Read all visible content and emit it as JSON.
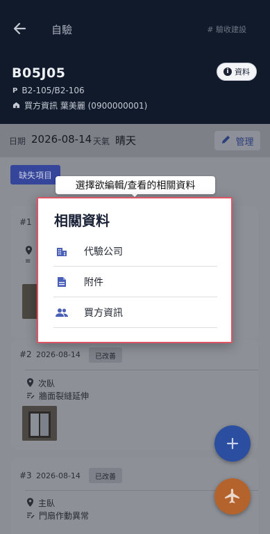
{
  "header": {
    "title": "自驗",
    "hashtag": "# 驗收建設",
    "code": "B05J05",
    "info_label": "資料",
    "unit_prefix": "P",
    "unit": "B2-105/B2-106",
    "buyer": "買方資訊 葉美麗 (0900000001)"
  },
  "datebar": {
    "date_label": "日期",
    "date_value": "2026-08-14",
    "weather_label": "天氣",
    "weather_value": "晴天",
    "manage_label": "管理"
  },
  "missing_label": "缺失項目",
  "cards": [
    {
      "num": "#1",
      "date": "",
      "status": "",
      "location": "",
      "issue": ""
    },
    {
      "num": "#2",
      "date": "2026-08-14",
      "status": "已改善",
      "location": "次臥",
      "issue": "牆面裂縫延伸"
    },
    {
      "num": "#3",
      "date": "2026-08-14",
      "status": "已改善",
      "location": "主臥",
      "issue": "門扇作動異常"
    }
  ],
  "tooltip": "選擇欲編輯/查看的相關資料",
  "modal": {
    "title": "相關資料",
    "items": [
      {
        "label": "代驗公司",
        "icon": "building-icon"
      },
      {
        "label": "附件",
        "icon": "document-icon"
      },
      {
        "label": "買方資訊",
        "icon": "people-icon"
      }
    ]
  },
  "colors": {
    "accent": "#34459a",
    "fab_add": "#2b4ea0",
    "fab_plane": "#b5632c",
    "highlight_border": "#e05365"
  }
}
